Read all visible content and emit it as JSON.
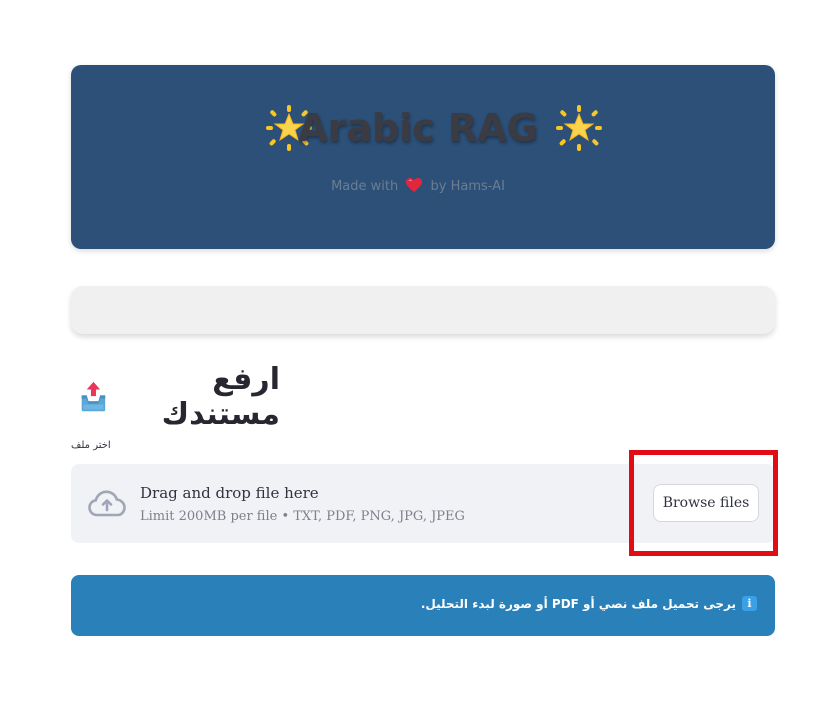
{
  "header": {
    "title": "Arabic RAG",
    "subtitle_prefix": "Made with",
    "subtitle_suffix": "by Hams-AI",
    "icons": [
      "glowing-star-icon",
      "heart-icon"
    ],
    "background": "#2c5078"
  },
  "upload_section": {
    "heading": "ارفع مستندك",
    "heading_icon": "inbox-upload-icon",
    "uploader_label": "اختر ملف",
    "dropzone_title": "Drag and drop file here",
    "dropzone_limit": "Limit 200MB per file • TXT, PDF, PNG, JPG, JPEG",
    "browse_button": "Browse files",
    "highlight_color": "#e00d17"
  },
  "info": {
    "message": "يرجى تحميل ملف نصي أو PDF أو صورة لبدء التحليل.",
    "icon": "info-icon",
    "background": "#2a80b9"
  }
}
